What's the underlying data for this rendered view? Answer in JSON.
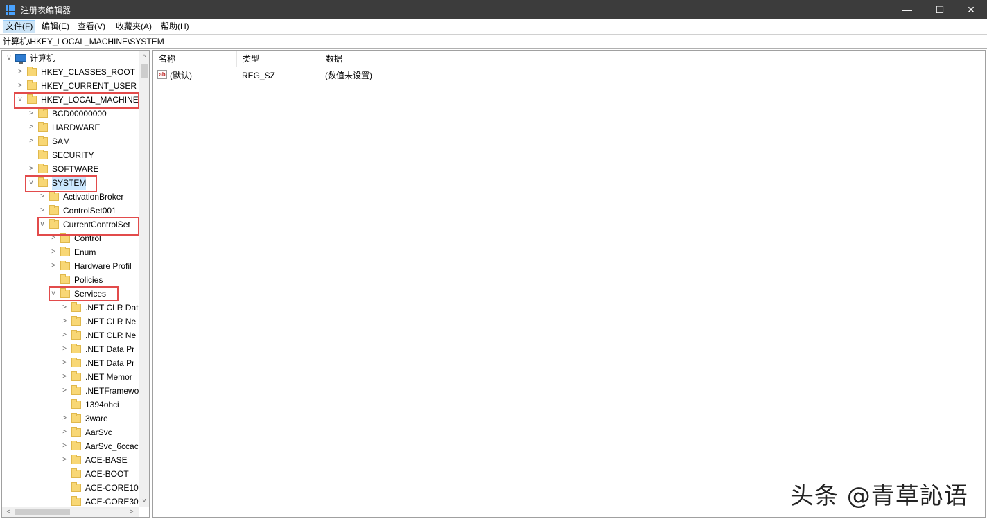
{
  "window": {
    "title": "注册表编辑器",
    "minimize": "—",
    "maximize": "☐",
    "close": "✕"
  },
  "menu": [
    {
      "label": "文件(F)"
    },
    {
      "label": "编辑(E)"
    },
    {
      "label": "查看(V)"
    },
    {
      "label": "收藏夹(A)"
    },
    {
      "label": "帮助(H)"
    }
  ],
  "address": "计算机\\HKEY_LOCAL_MACHINE\\SYSTEM",
  "tree": {
    "root": "计算机",
    "items": [
      {
        "label": "HKEY_CLASSES_ROOT",
        "level": 1,
        "expander": ">"
      },
      {
        "label": "HKEY_CURRENT_USER",
        "level": 1,
        "expander": ">"
      },
      {
        "label": "HKEY_LOCAL_MACHINE",
        "level": 1,
        "expander": "v"
      },
      {
        "label": "BCD00000000",
        "level": 2,
        "expander": ">"
      },
      {
        "label": "HARDWARE",
        "level": 2,
        "expander": ">"
      },
      {
        "label": "SAM",
        "level": 2,
        "expander": ">"
      },
      {
        "label": "SECURITY",
        "level": 2,
        "expander": ""
      },
      {
        "label": "SOFTWARE",
        "level": 2,
        "expander": ">"
      },
      {
        "label": "SYSTEM",
        "level": 2,
        "expander": "v"
      },
      {
        "label": "ActivationBroker",
        "level": 3,
        "expander": ">"
      },
      {
        "label": "ControlSet001",
        "level": 3,
        "expander": ">"
      },
      {
        "label": "CurrentControlSet",
        "level": 3,
        "expander": "v"
      },
      {
        "label": "Control",
        "level": 4,
        "expander": ">"
      },
      {
        "label": "Enum",
        "level": 4,
        "expander": ">"
      },
      {
        "label": "Hardware Profil",
        "level": 4,
        "expander": ">"
      },
      {
        "label": "Policies",
        "level": 4,
        "expander": ""
      },
      {
        "label": "Services",
        "level": 4,
        "expander": "v"
      },
      {
        "label": ".NET CLR Dat",
        "level": 5,
        "expander": ">"
      },
      {
        "label": ".NET CLR Ne",
        "level": 5,
        "expander": ">"
      },
      {
        "label": ".NET CLR Ne",
        "level": 5,
        "expander": ">"
      },
      {
        "label": ".NET Data Pr",
        "level": 5,
        "expander": ">"
      },
      {
        "label": ".NET Data Pr",
        "level": 5,
        "expander": ">"
      },
      {
        "label": ".NET Memor",
        "level": 5,
        "expander": ">"
      },
      {
        "label": ".NETFramewo",
        "level": 5,
        "expander": ">"
      },
      {
        "label": "1394ohci",
        "level": 5,
        "expander": ""
      },
      {
        "label": "3ware",
        "level": 5,
        "expander": ">"
      },
      {
        "label": "AarSvc",
        "level": 5,
        "expander": ">"
      },
      {
        "label": "AarSvc_6ccac",
        "level": 5,
        "expander": ">"
      },
      {
        "label": "ACE-BASE",
        "level": 5,
        "expander": ">"
      },
      {
        "label": "ACE-BOOT",
        "level": 5,
        "expander": ""
      },
      {
        "label": "ACE-CORE10",
        "level": 5,
        "expander": ""
      },
      {
        "label": "ACE-CORE30",
        "level": 5,
        "expander": ""
      }
    ]
  },
  "list": {
    "headers": {
      "name": "名称",
      "type": "类型",
      "data": "数据"
    },
    "rows": [
      {
        "icon": "ab",
        "name": "(默认)",
        "type": "REG_SZ",
        "data": "(数值未设置)"
      }
    ]
  },
  "watermark": "头条 @青草訫语"
}
